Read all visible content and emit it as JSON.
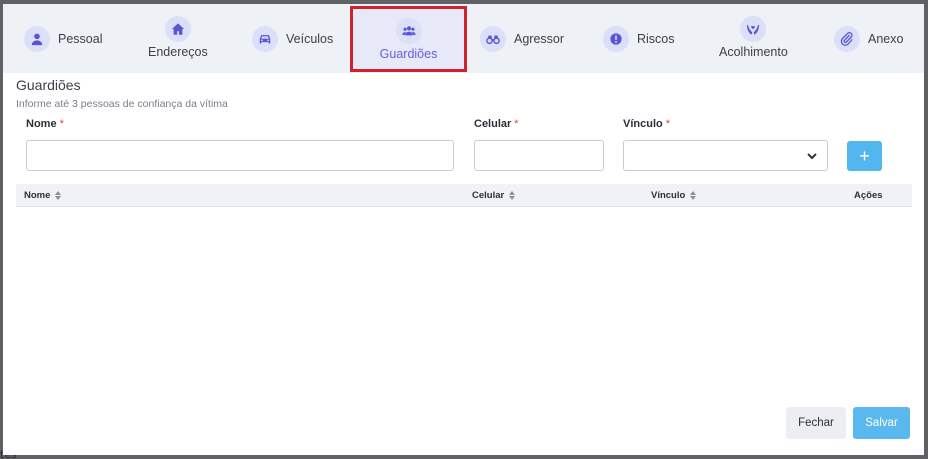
{
  "tabs": [
    {
      "label": "Pessoal",
      "icon": "user-icon"
    },
    {
      "label": "Endereços",
      "icon": "home-icon"
    },
    {
      "label": "Veículos",
      "icon": "car-icon"
    },
    {
      "label": "Guardiões",
      "icon": "users-icon",
      "active": true
    },
    {
      "label": "Agressor",
      "icon": "binoculars-icon"
    },
    {
      "label": "Riscos",
      "icon": "alert-icon"
    },
    {
      "label": "Acolhimento",
      "icon": "hands-icon"
    },
    {
      "label": "Anexo",
      "icon": "paperclip-icon"
    }
  ],
  "section": {
    "title": "Guardiões",
    "subtitle": "Informe até 3 pessoas de confiança da vítima"
  },
  "form": {
    "nome_label": "Nome",
    "celular_label": "Celular",
    "vinculo_label": "Vínculo",
    "required_mark": "*",
    "nome_value": "",
    "celular_value": "",
    "vinculo_value": "",
    "add_label": "+"
  },
  "table": {
    "columns": [
      "Nome",
      "Celular",
      "Vínculo",
      "Ações"
    ],
    "rows": []
  },
  "footer": {
    "close_label": "Fechar",
    "save_label": "Salvar"
  },
  "colors": {
    "accent": "#6461db",
    "primary_button": "#53b6ef",
    "highlight_border": "#d0222b"
  }
}
